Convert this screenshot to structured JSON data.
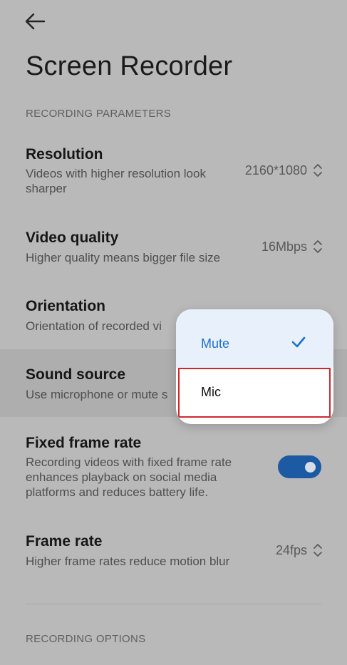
{
  "header": {
    "title": "Screen Recorder"
  },
  "sections": {
    "params": "RECORDING PARAMETERS",
    "options": "RECORDING OPTIONS"
  },
  "settings": {
    "resolution": {
      "title": "Resolution",
      "subtitle": "Videos with higher resolution look sharper",
      "value": "2160*1080"
    },
    "quality": {
      "title": "Video quality",
      "subtitle": "Higher quality means bigger file size",
      "value": "16Mbps"
    },
    "orientation": {
      "title": "Orientation",
      "subtitle": "Orientation of recorded vi"
    },
    "sound": {
      "title": "Sound source",
      "subtitle": "Use microphone or mute s"
    },
    "fixed_rate": {
      "title": "Fixed frame rate",
      "subtitle": "Recording videos with fixed frame rate enhances playback on social media platforms and reduces battery life.",
      "enabled": true
    },
    "frame_rate": {
      "title": "Frame rate",
      "subtitle": "Higher frame rates reduce motion blur",
      "value": "24fps"
    }
  },
  "popup": {
    "options": [
      {
        "label": "Mute",
        "selected": true
      },
      {
        "label": "Mic",
        "selected": false
      }
    ]
  },
  "colors": {
    "accent": "#1c5aa4",
    "selected_text": "#1b70c9",
    "highlight_border": "#d0282e"
  },
  "icons": {
    "back": "arrow-left-icon",
    "chevron": "chevron-up-down-icon",
    "check": "check-icon"
  }
}
